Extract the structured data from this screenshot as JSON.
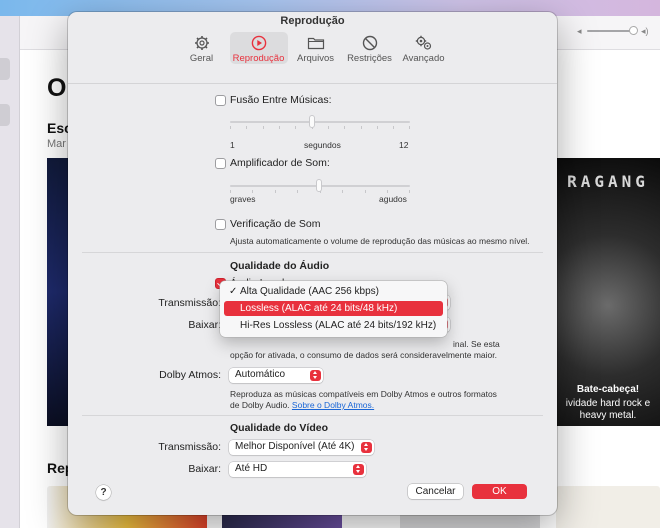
{
  "background": {
    "big_title": "O",
    "section_title": "Esc",
    "section_subtitle": "Mar",
    "section2_title": "Rep",
    "featured": {
      "band_text": "RAGANG",
      "title": "Bate-cabeça!",
      "subtitle": "ividade hard rock e heavy metal."
    }
  },
  "window": {
    "title": "Reprodução",
    "tabs": [
      {
        "label": "Geral",
        "icon": "gear-icon"
      },
      {
        "label": "Reprodução",
        "icon": "play-circle-icon"
      },
      {
        "label": "Arquivos",
        "icon": "folder-icon"
      },
      {
        "label": "Restrições",
        "icon": "restriction-icon"
      },
      {
        "label": "Avançado",
        "icon": "gears-icon"
      }
    ],
    "active_tab": "Reprodução"
  },
  "playback": {
    "crossfade": {
      "label": "Fusão Entre Músicas:",
      "checked": false,
      "min": "1",
      "unit": "segundos",
      "max": "12"
    },
    "sound_enhancer": {
      "label": "Amplificador de Som:",
      "checked": false,
      "low": "graves",
      "high": "agudos"
    },
    "sound_check": {
      "label": "Verificação de Som",
      "checked": false,
      "description": "Ajusta automaticamente o volume de reprodução das músicas ao mesmo nível."
    }
  },
  "audio_quality": {
    "heading": "Qualidade do Áudio",
    "lossless": {
      "label": "Áudio Lossless",
      "checked": true
    },
    "streaming_label": "Transmissão:",
    "download_label": "Baixar:",
    "menu_options": [
      {
        "label": "Alta Qualidade (AAC 256 kbps)",
        "selected": true
      },
      {
        "label": "Lossless (ALAC até 24 bits/48 kHz)",
        "highlighted": true
      },
      {
        "label": "Hi-Res Lossless (ALAC até 24 bits/192 kHz)"
      }
    ],
    "note_fragment": "inal. Se esta",
    "note_line2": "opção for ativada, o consumo de dados será consideravelmente maior."
  },
  "dolby": {
    "label": "Dolby Atmos:",
    "value": "Automático",
    "desc_line1": "Reproduza as músicas compatíveis em Dolby Atmos e outros formatos",
    "desc_line2": "de Dolby Audio.",
    "link": "Sobre o Dolby Atmos."
  },
  "video_quality": {
    "heading": "Qualidade do Vídeo",
    "streaming_label": "Transmissão:",
    "streaming_value": "Melhor Disponível (Até 4K)",
    "download_label": "Baixar:",
    "download_value": "Até HD"
  },
  "footer": {
    "help": "?",
    "cancel": "Cancelar",
    "ok": "OK"
  },
  "colors": {
    "accent": "#e8313d"
  }
}
